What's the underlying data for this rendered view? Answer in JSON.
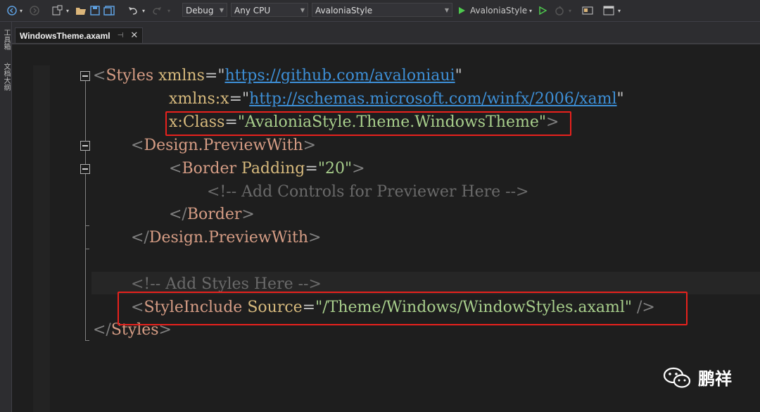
{
  "toolbar": {
    "config": "Debug",
    "platform": "Any CPU",
    "project": "AvaloniaStyle",
    "run_target": "AvaloniaStyle"
  },
  "sidebar": {
    "toolbox": "工具箱",
    "outline": "文档大纲"
  },
  "tab": {
    "title": "WindowsTheme.axaml"
  },
  "code": {
    "l1_open": "<",
    "l1_tag": "Styles",
    "l1_attr": "xmlns",
    "l1_eq": "=",
    "l1_q1": "\"",
    "l1_val": "https://github.com/avaloniaui",
    "l1_q2": "\"",
    "l2_attr": "xmlns:x",
    "l2_eq": "=",
    "l2_q1": "\"",
    "l2_val": "http://schemas.microsoft.com/winfx/2006/xaml",
    "l2_q2": "\"",
    "l3_attr": "x:Class",
    "l3_eq": "=",
    "l3_val": "\"AvaloniaStyle.Theme.WindowsTheme\"",
    "l3_close": ">",
    "l4_open": "<",
    "l4_tag": "Design.PreviewWith",
    "l4_close": ">",
    "l5_open": "<",
    "l5_tag": "Border",
    "l5_attr": "Padding",
    "l5_eq": "=",
    "l5_val": "\"20\"",
    "l5_close": ">",
    "l6_comment": "<!-- Add Controls for Previewer Here -->",
    "l7_open": "</",
    "l7_tag": "Border",
    "l7_close": ">",
    "l8_open": "</",
    "l8_tag": "Design.PreviewWith",
    "l8_close": ">",
    "l9_comment": "<!-- Add Styles Here -->",
    "l10_open": "<",
    "l10_tag": "StyleInclude",
    "l10_attr": "Source",
    "l10_eq": "=",
    "l10_val": "\"/Theme/Windows/WindowStyles.axaml\"",
    "l10_close": " />",
    "l11_open": "</",
    "l11_tag": "Styles",
    "l11_close": ">"
  },
  "watermark": {
    "text": "鹏祥"
  },
  "colors": {
    "highlight_box": "#e8211d",
    "background": "#1e1e1e"
  }
}
